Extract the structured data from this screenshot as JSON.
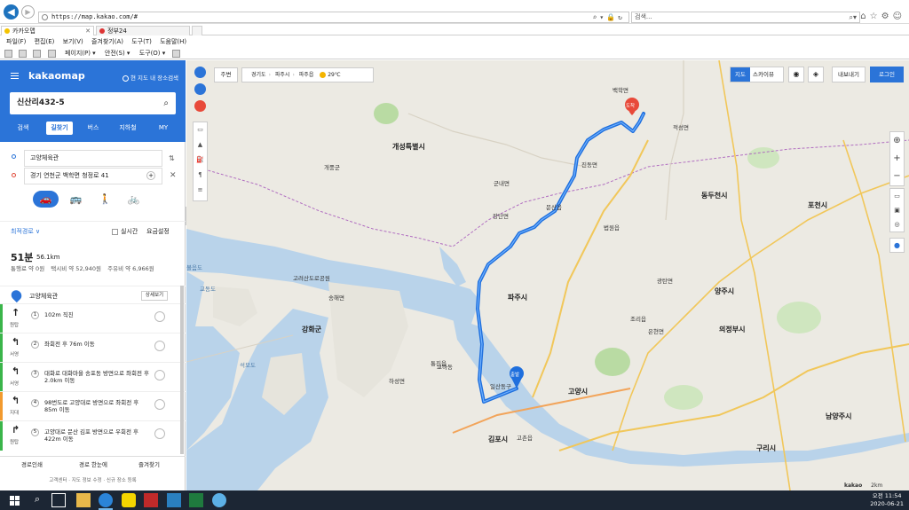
{
  "browser": {
    "url": "https://map.kakao.com/#",
    "search_placeholder": "검색...",
    "tabs": [
      {
        "label": "카카오맵"
      },
      {
        "label": "정부24"
      }
    ],
    "menu": [
      "파일(F)",
      "편집(E)",
      "보기(V)",
      "즐겨찾기(A)",
      "도구(T)",
      "도움말(H)"
    ],
    "cmd": {
      "page": "페이지(P) ▾",
      "safety": "안전(S) ▾",
      "tools": "도구(O) ▾"
    }
  },
  "panel": {
    "logo": "kakaomap",
    "mypos": "현 지도 내 장소검색",
    "search_value": "신산리432-5",
    "tabs": [
      "검색",
      "길찾기",
      "버스",
      "지하철",
      "MY"
    ],
    "origin": "고양체육관",
    "destination": "경기 연천군 백학면 청정로 41",
    "route_option": "최적경로 ∨",
    "realtime": "실시간",
    "fare_setting": "요금설정",
    "time": "51분",
    "distance": "56.1km",
    "costs": [
      "통행료 약 0원",
      "택시비 약 52,940원",
      "주유비 약 6,966원"
    ],
    "start_name": "고양체육관",
    "detail_btn": "상세보기",
    "steps": [
      {
        "num": "1",
        "dir": "원탑",
        "arrow": "↑",
        "text": "102m 직진",
        "color": "#3ab54a"
      },
      {
        "num": "2",
        "dir": "서영",
        "arrow": "↰",
        "text": "좌회전 후 76m 이동",
        "color": "#3ab54a"
      },
      {
        "num": "3",
        "dir": "서영",
        "arrow": "↰",
        "text": "대화로 대화마을 송포동 방면으로 좌회전 후 2.0km 이동",
        "color": "#3ab54a"
      },
      {
        "num": "4",
        "dir": "지대",
        "arrow": "↰",
        "text": "98번도로 고양대로 방면으로 좌회전 후 85m 이동",
        "color": "#f29a2e"
      },
      {
        "num": "5",
        "dir": "원탑",
        "arrow": "↱",
        "text": "고양대로 문산 김포 방면으로 우회전 후 422m 이동",
        "color": "#3ab54a"
      }
    ],
    "footer": {
      "print": "경로인쇄",
      "share": "경로 한눈에",
      "favorite": "즐겨찾기"
    },
    "links": "고객센터 · 지도 정보 수정 · 신규 장소 등록"
  },
  "map": {
    "around": "주변",
    "breadcrumb": [
      "경기도",
      "파주시",
      "파주읍"
    ],
    "weather": "29℃",
    "type_map": "지도",
    "type_sky": "스카이뷰",
    "share": "내보내기",
    "login": "로그인",
    "end_marker": "도착",
    "start_marker": "출발",
    "scale": "2km",
    "brand": "kakao",
    "labels": [
      {
        "text": "개성특별시",
        "cls": "big"
      },
      {
        "text": "개풍군",
        "cls": ""
      },
      {
        "text": "고려산도로공원",
        "cls": ""
      },
      {
        "text": "송해면",
        "cls": ""
      },
      {
        "text": "강화군",
        "cls": "big"
      },
      {
        "text": "김포시",
        "cls": "big"
      },
      {
        "text": "파주시",
        "cls": "big"
      },
      {
        "text": "고양시",
        "cls": "big"
      },
      {
        "text": "양주시",
        "cls": "big"
      },
      {
        "text": "동두천시",
        "cls": "big"
      },
      {
        "text": "의정부시",
        "cls": "big"
      },
      {
        "text": "포천시",
        "cls": "big"
      },
      {
        "text": "남양주시",
        "cls": "big"
      },
      {
        "text": "구리시",
        "cls": "big"
      },
      {
        "text": "교동도",
        "cls": "water"
      },
      {
        "text": "석모도",
        "cls": "water"
      },
      {
        "text": "볼음도",
        "cls": "water"
      },
      {
        "text": "장단면",
        "cls": ""
      },
      {
        "text": "적성면",
        "cls": ""
      },
      {
        "text": "법원읍",
        "cls": ""
      },
      {
        "text": "광탄면",
        "cls": ""
      },
      {
        "text": "백학면",
        "cls": ""
      },
      {
        "text": "진동면",
        "cls": ""
      },
      {
        "text": "군내면",
        "cls": ""
      },
      {
        "text": "은현면",
        "cls": ""
      },
      {
        "text": "조리읍",
        "cls": ""
      },
      {
        "text": "일산동구",
        "cls": ""
      },
      {
        "text": "고촌읍",
        "cls": ""
      },
      {
        "text": "통진읍",
        "cls": ""
      },
      {
        "text": "하성면",
        "cls": ""
      },
      {
        "text": "교하동",
        "cls": ""
      },
      {
        "text": "문산읍",
        "cls": ""
      }
    ]
  },
  "taskbar": {
    "time": "오전 11:54",
    "date": "2020-06-21"
  }
}
